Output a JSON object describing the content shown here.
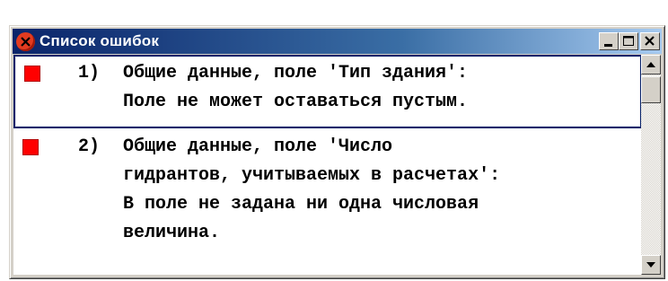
{
  "window": {
    "title": "Список ошибок",
    "controls": {
      "minimize": "minimize-icon",
      "maximize": "maximize-icon",
      "close": "close-icon"
    }
  },
  "errors": [
    {
      "number": "1)",
      "lines": [
        "Общие данные, поле 'Тип здания':",
        "Поле не может оставаться пустым."
      ],
      "selected": true
    },
    {
      "number": "2)",
      "lines": [
        "Общие данные, поле 'Число",
        "гидрантов, учитываемых в расчетах':",
        "В поле не задана ни одна числовая",
        "величина."
      ],
      "selected": false
    }
  ],
  "colors": {
    "marker": "#ff0000",
    "titlebar_start": "#0a246a",
    "titlebar_end": "#a6caf0"
  }
}
